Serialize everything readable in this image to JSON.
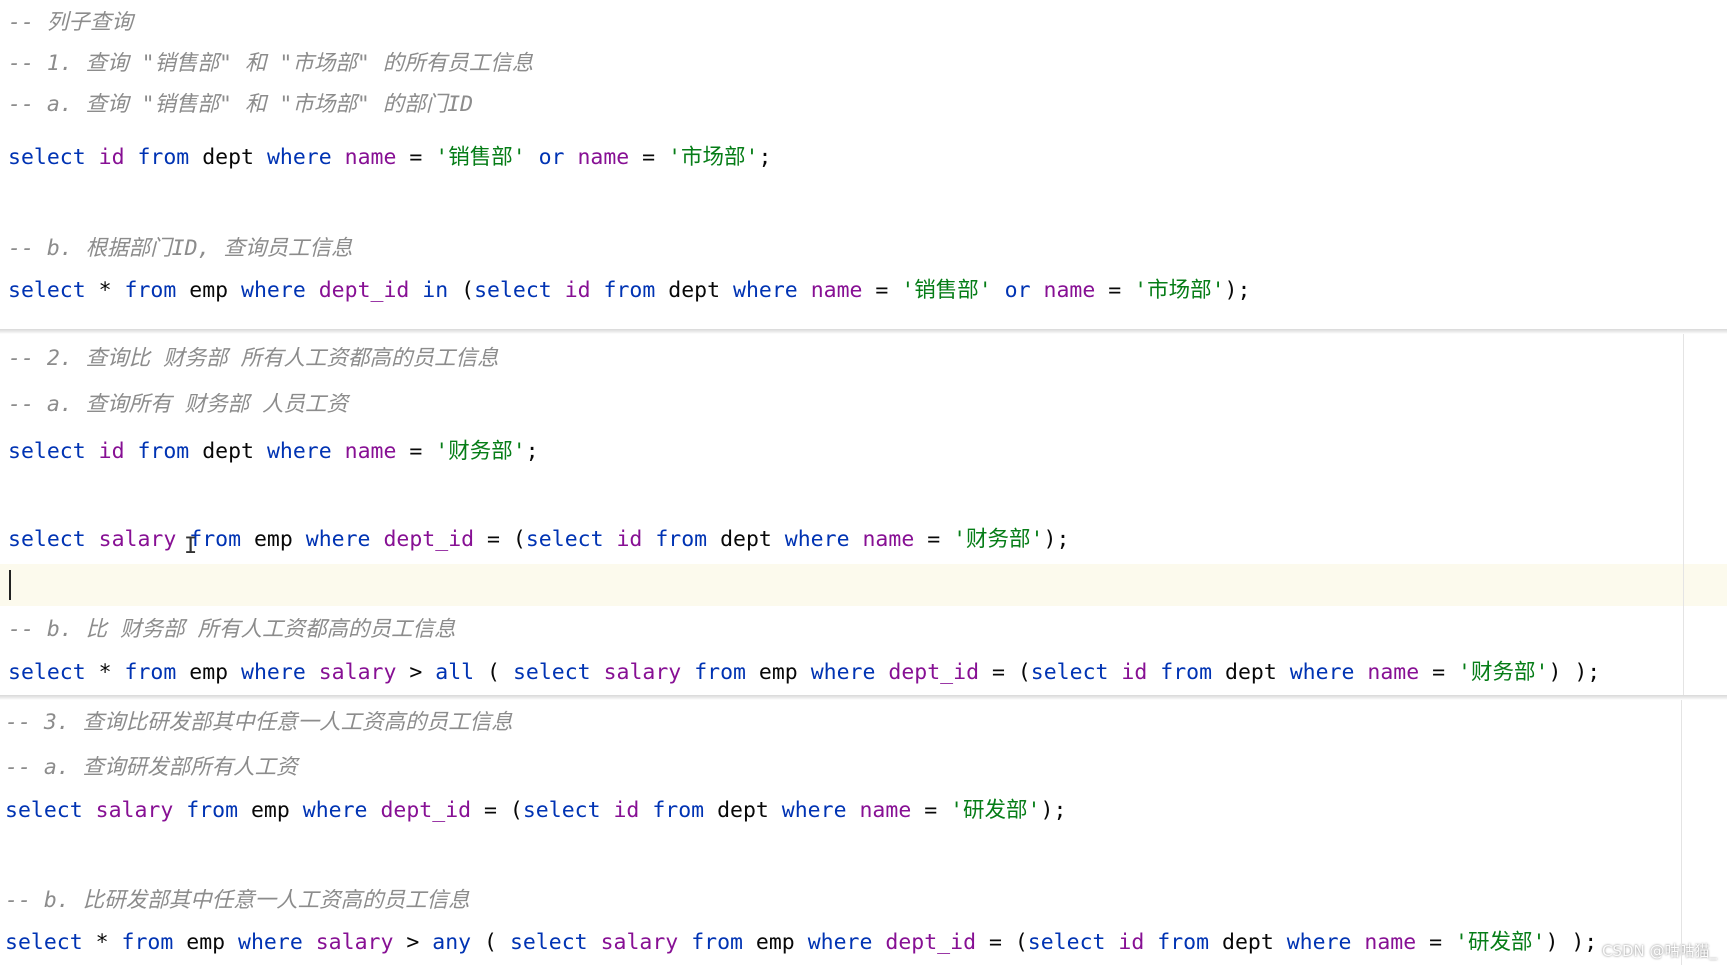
{
  "editor": {
    "section1": {
      "comment_title": "-- 列子查询",
      "comment_q1": "-- 1. 查询 \"销售部\" 和 \"市场部\" 的所有员工信息",
      "comment_a": "-- a. 查询 \"销售部\" 和 \"市场部\" 的部门ID",
      "sql_a": [
        {
          "t": "select",
          "c": "kw"
        },
        {
          "t": " "
        },
        {
          "t": "id",
          "c": "col"
        },
        {
          "t": " "
        },
        {
          "t": "from",
          "c": "kw"
        },
        {
          "t": " "
        },
        {
          "t": "dept",
          "c": "tbl"
        },
        {
          "t": " "
        },
        {
          "t": "where",
          "c": "kw"
        },
        {
          "t": " "
        },
        {
          "t": "name",
          "c": "col"
        },
        {
          "t": " = ",
          "c": "op"
        },
        {
          "t": "'销售部'",
          "c": "str"
        },
        {
          "t": " "
        },
        {
          "t": "or",
          "c": "kw"
        },
        {
          "t": " "
        },
        {
          "t": "name",
          "c": "col"
        },
        {
          "t": " = ",
          "c": "op"
        },
        {
          "t": "'市场部'",
          "c": "str"
        },
        {
          "t": ";",
          "c": "op"
        }
      ],
      "comment_b": "-- b. 根据部门ID, 查询员工信息",
      "sql_b": [
        {
          "t": "select",
          "c": "kw"
        },
        {
          "t": " * ",
          "c": "op"
        },
        {
          "t": "from",
          "c": "kw"
        },
        {
          "t": " "
        },
        {
          "t": "emp",
          "c": "tbl"
        },
        {
          "t": " "
        },
        {
          "t": "where",
          "c": "kw"
        },
        {
          "t": " "
        },
        {
          "t": "dept_id",
          "c": "col"
        },
        {
          "t": " "
        },
        {
          "t": "in",
          "c": "kw"
        },
        {
          "t": " (",
          "c": "op"
        },
        {
          "t": "select",
          "c": "kw"
        },
        {
          "t": " "
        },
        {
          "t": "id",
          "c": "col"
        },
        {
          "t": " "
        },
        {
          "t": "from",
          "c": "kw"
        },
        {
          "t": " "
        },
        {
          "t": "dept",
          "c": "tbl"
        },
        {
          "t": " "
        },
        {
          "t": "where",
          "c": "kw"
        },
        {
          "t": " "
        },
        {
          "t": "name",
          "c": "col"
        },
        {
          "t": " = ",
          "c": "op"
        },
        {
          "t": "'销售部'",
          "c": "str"
        },
        {
          "t": " "
        },
        {
          "t": "or",
          "c": "kw"
        },
        {
          "t": " "
        },
        {
          "t": "name",
          "c": "col"
        },
        {
          "t": " = ",
          "c": "op"
        },
        {
          "t": "'市场部'",
          "c": "str"
        },
        {
          "t": ");",
          "c": "op"
        }
      ]
    },
    "section2": {
      "comment_q2": "-- 2. 查询比 财务部 所有人工资都高的员工信息",
      "comment_a": "-- a. 查询所有 财务部 人员工资",
      "sql_a": [
        {
          "t": "select",
          "c": "kw"
        },
        {
          "t": " "
        },
        {
          "t": "id",
          "c": "col"
        },
        {
          "t": " "
        },
        {
          "t": "from",
          "c": "kw"
        },
        {
          "t": " "
        },
        {
          "t": "dept",
          "c": "tbl"
        },
        {
          "t": " "
        },
        {
          "t": "where",
          "c": "kw"
        },
        {
          "t": " "
        },
        {
          "t": "name",
          "c": "col"
        },
        {
          "t": " = ",
          "c": "op"
        },
        {
          "t": "'财务部'",
          "c": "str"
        },
        {
          "t": ";",
          "c": "op"
        }
      ],
      "sql_a2": [
        {
          "t": "select",
          "c": "kw"
        },
        {
          "t": " "
        },
        {
          "t": "salary",
          "c": "col"
        },
        {
          "t": " "
        },
        {
          "t": "from",
          "c": "kw"
        },
        {
          "t": " "
        },
        {
          "t": "emp",
          "c": "tbl"
        },
        {
          "t": " "
        },
        {
          "t": "where",
          "c": "kw"
        },
        {
          "t": " "
        },
        {
          "t": "dept_id",
          "c": "col"
        },
        {
          "t": " = (",
          "c": "op"
        },
        {
          "t": "select",
          "c": "kw"
        },
        {
          "t": " "
        },
        {
          "t": "id",
          "c": "col"
        },
        {
          "t": " "
        },
        {
          "t": "from",
          "c": "kw"
        },
        {
          "t": " "
        },
        {
          "t": "dept",
          "c": "tbl"
        },
        {
          "t": " "
        },
        {
          "t": "where",
          "c": "kw"
        },
        {
          "t": " "
        },
        {
          "t": "name",
          "c": "col"
        },
        {
          "t": " = ",
          "c": "op"
        },
        {
          "t": "'财务部'",
          "c": "str"
        },
        {
          "t": ");",
          "c": "op"
        }
      ],
      "comment_b": "-- b. 比 财务部 所有人工资都高的员工信息",
      "sql_b": [
        {
          "t": "select",
          "c": "kw"
        },
        {
          "t": " * ",
          "c": "op"
        },
        {
          "t": "from",
          "c": "kw"
        },
        {
          "t": " "
        },
        {
          "t": "emp",
          "c": "tbl"
        },
        {
          "t": " "
        },
        {
          "t": "where",
          "c": "kw"
        },
        {
          "t": " "
        },
        {
          "t": "salary",
          "c": "col"
        },
        {
          "t": " > ",
          "c": "op"
        },
        {
          "t": "all",
          "c": "kw"
        },
        {
          "t": " ( ",
          "c": "op"
        },
        {
          "t": "select",
          "c": "kw"
        },
        {
          "t": " "
        },
        {
          "t": "salary",
          "c": "col"
        },
        {
          "t": " "
        },
        {
          "t": "from",
          "c": "kw"
        },
        {
          "t": " "
        },
        {
          "t": "emp",
          "c": "tbl"
        },
        {
          "t": " "
        },
        {
          "t": "where",
          "c": "kw"
        },
        {
          "t": " "
        },
        {
          "t": "dept_id",
          "c": "col"
        },
        {
          "t": " = (",
          "c": "op"
        },
        {
          "t": "select",
          "c": "kw"
        },
        {
          "t": " "
        },
        {
          "t": "id",
          "c": "col"
        },
        {
          "t": " "
        },
        {
          "t": "from",
          "c": "kw"
        },
        {
          "t": " "
        },
        {
          "t": "dept",
          "c": "tbl"
        },
        {
          "t": " "
        },
        {
          "t": "where",
          "c": "kw"
        },
        {
          "t": " "
        },
        {
          "t": "name",
          "c": "col"
        },
        {
          "t": " = ",
          "c": "op"
        },
        {
          "t": "'财务部'",
          "c": "str"
        },
        {
          "t": ") );",
          "c": "op"
        }
      ]
    },
    "section3": {
      "comment_q3": "-- 3. 查询比研发部其中任意一人工资高的员工信息",
      "comment_a": "-- a. 查询研发部所有人工资",
      "sql_a": [
        {
          "t": "select",
          "c": "kw"
        },
        {
          "t": " "
        },
        {
          "t": "salary",
          "c": "col"
        },
        {
          "t": " "
        },
        {
          "t": "from",
          "c": "kw"
        },
        {
          "t": " "
        },
        {
          "t": "emp",
          "c": "tbl"
        },
        {
          "t": " "
        },
        {
          "t": "where",
          "c": "kw"
        },
        {
          "t": " "
        },
        {
          "t": "dept_id",
          "c": "col"
        },
        {
          "t": " = (",
          "c": "op"
        },
        {
          "t": "select",
          "c": "kw"
        },
        {
          "t": " "
        },
        {
          "t": "id",
          "c": "col"
        },
        {
          "t": " "
        },
        {
          "t": "from",
          "c": "kw"
        },
        {
          "t": " "
        },
        {
          "t": "dept",
          "c": "tbl"
        },
        {
          "t": " "
        },
        {
          "t": "where",
          "c": "kw"
        },
        {
          "t": " "
        },
        {
          "t": "name",
          "c": "col"
        },
        {
          "t": " = ",
          "c": "op"
        },
        {
          "t": "'研发部'",
          "c": "str"
        },
        {
          "t": ");",
          "c": "op"
        }
      ],
      "comment_b": "-- b. 比研发部其中任意一人工资高的员工信息",
      "sql_b": [
        {
          "t": "select",
          "c": "kw"
        },
        {
          "t": " * ",
          "c": "op"
        },
        {
          "t": "from",
          "c": "kw"
        },
        {
          "t": " "
        },
        {
          "t": "emp",
          "c": "tbl"
        },
        {
          "t": " "
        },
        {
          "t": "where",
          "c": "kw"
        },
        {
          "t": " "
        },
        {
          "t": "salary",
          "c": "col"
        },
        {
          "t": " > ",
          "c": "op"
        },
        {
          "t": "any",
          "c": "kw"
        },
        {
          "t": " ( ",
          "c": "op"
        },
        {
          "t": "select",
          "c": "kw"
        },
        {
          "t": " "
        },
        {
          "t": "salary",
          "c": "col"
        },
        {
          "t": " "
        },
        {
          "t": "from",
          "c": "kw"
        },
        {
          "t": " "
        },
        {
          "t": "emp",
          "c": "tbl"
        },
        {
          "t": " "
        },
        {
          "t": "where",
          "c": "kw"
        },
        {
          "t": " "
        },
        {
          "t": "dept_id",
          "c": "col"
        },
        {
          "t": " = (",
          "c": "op"
        },
        {
          "t": "select",
          "c": "kw"
        },
        {
          "t": " "
        },
        {
          "t": "id",
          "c": "col"
        },
        {
          "t": " "
        },
        {
          "t": "from",
          "c": "kw"
        },
        {
          "t": " "
        },
        {
          "t": "dept",
          "c": "tbl"
        },
        {
          "t": " "
        },
        {
          "t": "where",
          "c": "kw"
        },
        {
          "t": " "
        },
        {
          "t": "name",
          "c": "col"
        },
        {
          "t": " = ",
          "c": "op"
        },
        {
          "t": "'研发部'",
          "c": "str"
        },
        {
          "t": ") );",
          "c": "op"
        }
      ]
    },
    "watermark": "CSDN @咕咕猫_",
    "colors": {
      "keyword": "#0033b3",
      "column": "#871094",
      "identifier": "#080808",
      "string": "#067d17",
      "comment": "#8c8c8c",
      "current_line": "#fcfaed"
    }
  }
}
